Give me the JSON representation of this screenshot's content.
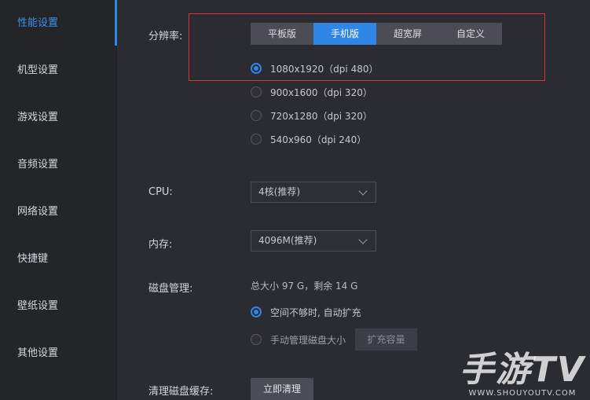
{
  "sidebar": {
    "items": [
      {
        "label": "性能设置"
      },
      {
        "label": "机型设置"
      },
      {
        "label": "游戏设置"
      },
      {
        "label": "音频设置"
      },
      {
        "label": "网络设置"
      },
      {
        "label": "快捷键"
      },
      {
        "label": "壁纸设置"
      },
      {
        "label": "其他设置"
      }
    ],
    "active": "性能设置"
  },
  "resolution": {
    "label": "分辨率:",
    "tabs": [
      "平板版",
      "手机版",
      "超宽屏",
      "自定义"
    ],
    "active_tab": "手机版",
    "options": [
      "1080x1920（dpi 480）",
      "900x1600（dpi 320）",
      "720x1280（dpi 320）",
      "540x960（dpi 240）"
    ],
    "selected": "1080x1920（dpi 480）"
  },
  "cpu": {
    "label": "CPU:",
    "value": "4核(推荐)"
  },
  "memory": {
    "label": "内存:",
    "value": "4096M(推荐)"
  },
  "disk": {
    "label": "磁盘管理:",
    "info": "总大小 97 G，剩余 14 G",
    "options": [
      "空间不够时, 自动扩充",
      "手动管理磁盘大小"
    ],
    "selected": "空间不够时, 自动扩充",
    "expand_button": "扩充容量"
  },
  "cache": {
    "label": "清理磁盘缓存:",
    "button": "立即清理"
  },
  "watermark": {
    "main": "手游TV",
    "sub": "WWW.SHOUYOUTV.COM"
  },
  "colors": {
    "accent": "#2f86e6",
    "highlight_box": "#d9323a",
    "background": "#2a2c31",
    "sidebar": "#232529"
  }
}
